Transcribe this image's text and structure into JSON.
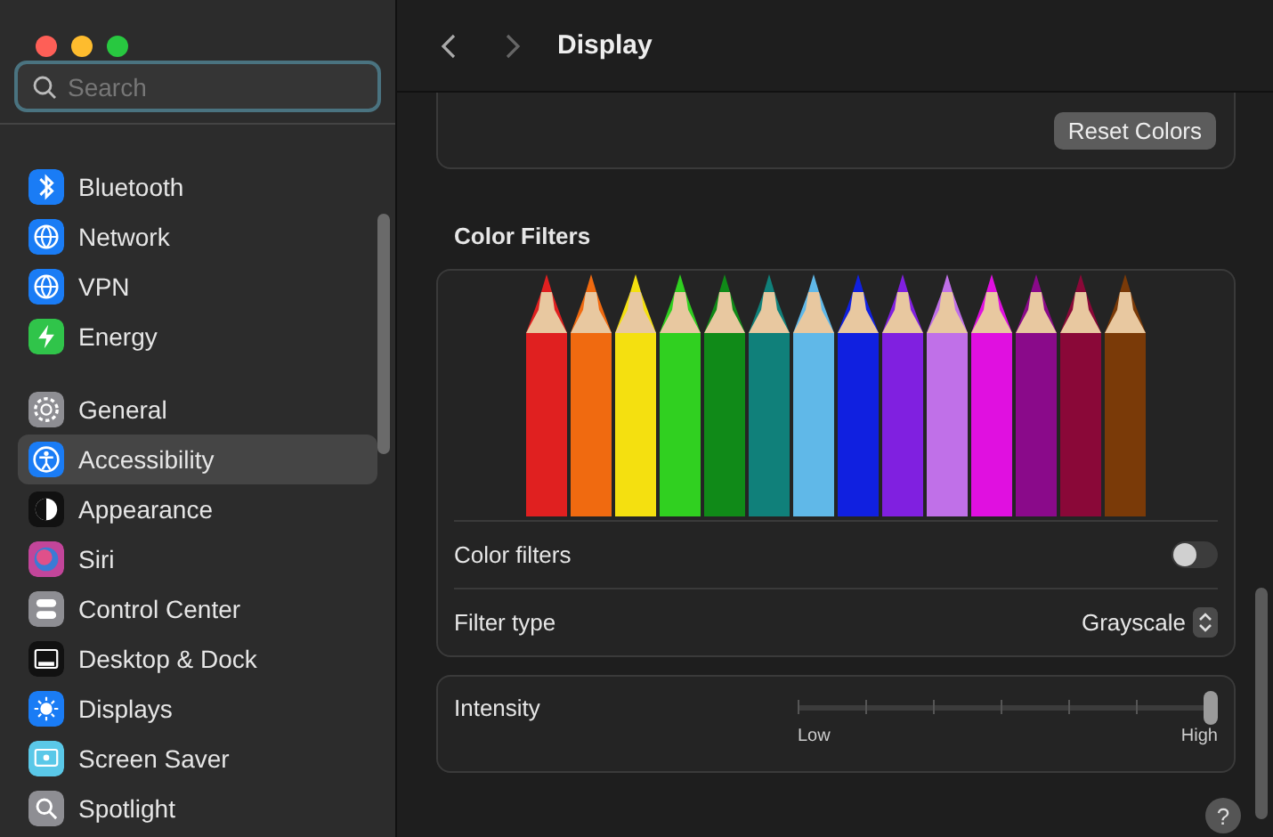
{
  "sidebar": {
    "search": {
      "placeholder": "Search"
    },
    "groups": [
      [
        {
          "label": "Bluetooth",
          "selected": false
        },
        {
          "label": "Network",
          "selected": false
        },
        {
          "label": "VPN",
          "selected": false
        },
        {
          "label": "Energy",
          "selected": false
        }
      ],
      [
        {
          "label": "General",
          "selected": false
        },
        {
          "label": "Accessibility",
          "selected": true
        },
        {
          "label": "Appearance",
          "selected": false
        },
        {
          "label": "Siri",
          "selected": false
        },
        {
          "label": "Control Center",
          "selected": false
        },
        {
          "label": "Desktop & Dock",
          "selected": false
        },
        {
          "label": "Displays",
          "selected": false
        },
        {
          "label": "Screen Saver",
          "selected": false
        },
        {
          "label": "Spotlight",
          "selected": false
        }
      ]
    ]
  },
  "toolbar": {
    "title": "Display"
  },
  "top_card": {
    "button": "Reset Colors"
  },
  "section": {
    "title": "Color Filters",
    "rows": [
      {
        "kind": "toggle",
        "label": "Color filters",
        "on": false
      },
      {
        "kind": "popup",
        "label": "Filter type",
        "value": "Grayscale"
      }
    ]
  },
  "intensity": {
    "label": "Intensity",
    "level": 1,
    "min_label": "Low",
    "max_label": "High"
  },
  "help": "?"
}
